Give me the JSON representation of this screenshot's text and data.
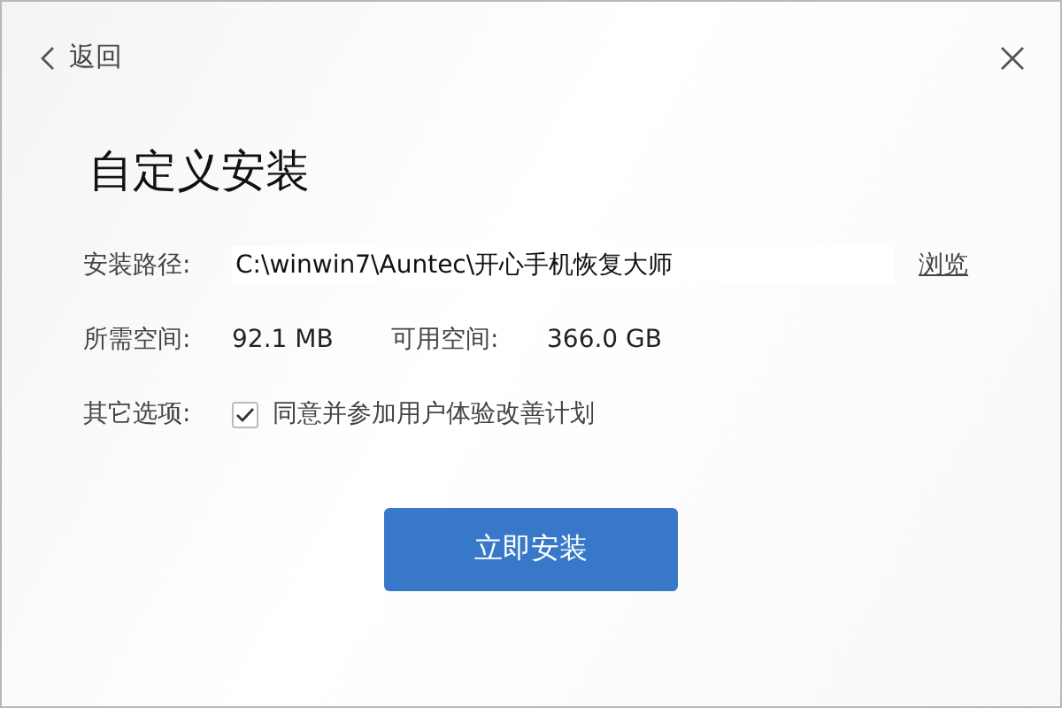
{
  "header": {
    "back_label": "返回"
  },
  "title": "自定义安装",
  "path": {
    "label": "安装路径:",
    "value": "C:\\winwin7\\Auntec\\开心手机恢复大师",
    "browse": "浏览"
  },
  "space": {
    "required_label": "所需空间:",
    "required": "92.1 MB",
    "available_label": "可用空间:",
    "available": "366.0 GB"
  },
  "options": {
    "label": "其它选项:",
    "items": [
      {
        "label": "同意并参加用户体验改善计划",
        "checked": true
      }
    ]
  },
  "install_button": "立即安装"
}
